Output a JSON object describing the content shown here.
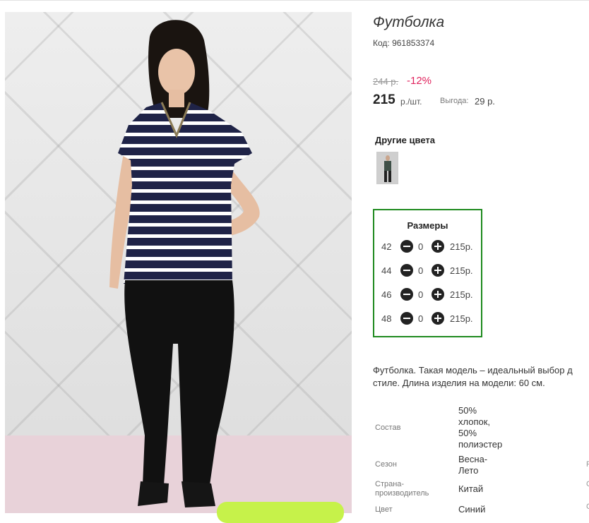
{
  "product": {
    "title": "Футболка",
    "code": "Код: 961853374",
    "old_price": "244 р.",
    "discount": "-12%",
    "price": "215",
    "unit": "р./шт.",
    "save_label": "Выгода:",
    "save_value": "29 р."
  },
  "other_colors": {
    "title": "Другие цвета"
  },
  "sizes": {
    "title": "Размеры",
    "rows": [
      {
        "size": "42",
        "qty": "0",
        "price": "215р."
      },
      {
        "size": "44",
        "qty": "0",
        "price": "215р."
      },
      {
        "size": "46",
        "qty": "0",
        "price": "215р."
      },
      {
        "size": "48",
        "qty": "0",
        "price": "215р."
      }
    ]
  },
  "description": {
    "line1": "Футболка. Такая модель – идеальный выбор д",
    "line2": "стиле. Длина изделия на модели: 60 см."
  },
  "properties": [
    {
      "label": [
        "Состав"
      ],
      "value": [
        "50%",
        "хлопок,",
        "50%",
        "полиэстер"
      ]
    },
    {
      "label": [
        "Сезон"
      ],
      "value": [
        "Весна-",
        "Лето"
      ]
    },
    {
      "label": [
        "Страна-",
        "производитель"
      ],
      "value": [
        "Китай"
      ]
    },
    {
      "label": [
        "Цвет"
      ],
      "value": [
        "Синий"
      ]
    }
  ],
  "edge_fragments": [
    "Р",
    "С",
    "С"
  ],
  "colors": {
    "discount": "#e0245e",
    "sizes_border": "#1e8a1e",
    "button_green": "#c6f24a",
    "shirt_navy": "#1f2347"
  }
}
